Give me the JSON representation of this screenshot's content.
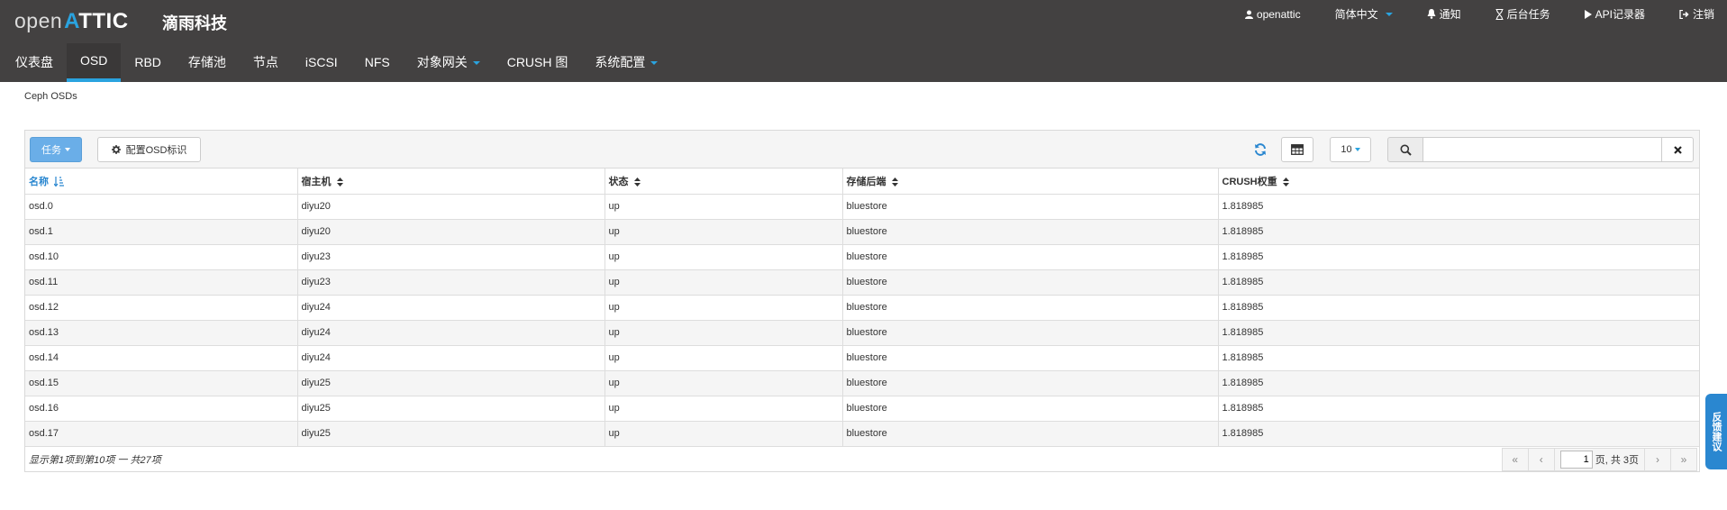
{
  "header": {
    "logo_open": "open",
    "logo_a": "A",
    "logo_ttic": "TTIC",
    "company": "滴雨科技",
    "user": "openattic",
    "language": "简体中文",
    "notifications": "通知",
    "background_tasks": "后台任务",
    "api_log": "API记录器",
    "logout": "注销"
  },
  "nav": {
    "tabs": [
      {
        "label": "仪表盘"
      },
      {
        "label": "OSD"
      },
      {
        "label": "RBD"
      },
      {
        "label": "存储池"
      },
      {
        "label": "节点"
      },
      {
        "label": "iSCSI"
      },
      {
        "label": "NFS"
      },
      {
        "label": "对象网关"
      },
      {
        "label": "CRUSH 图"
      },
      {
        "label": "系统配置"
      }
    ],
    "active": "OSD"
  },
  "breadcrumb": "Ceph OSDs",
  "toolbar": {
    "tasks_label": "任务",
    "configure_label": "配置OSD标识",
    "page_size": "10",
    "search_value": ""
  },
  "table": {
    "columns": [
      "名称",
      "宿主机",
      "状态",
      "存储后端",
      "CRUSH权重"
    ],
    "rows": [
      [
        "osd.0",
        "diyu20",
        "up",
        "bluestore",
        "1.818985"
      ],
      [
        "osd.1",
        "diyu20",
        "up",
        "bluestore",
        "1.818985"
      ],
      [
        "osd.10",
        "diyu23",
        "up",
        "bluestore",
        "1.818985"
      ],
      [
        "osd.11",
        "diyu23",
        "up",
        "bluestore",
        "1.818985"
      ],
      [
        "osd.12",
        "diyu24",
        "up",
        "bluestore",
        "1.818985"
      ],
      [
        "osd.13",
        "diyu24",
        "up",
        "bluestore",
        "1.818985"
      ],
      [
        "osd.14",
        "diyu24",
        "up",
        "bluestore",
        "1.818985"
      ],
      [
        "osd.15",
        "diyu25",
        "up",
        "bluestore",
        "1.818985"
      ],
      [
        "osd.16",
        "diyu25",
        "up",
        "bluestore",
        "1.818985"
      ],
      [
        "osd.17",
        "diyu25",
        "up",
        "bluestore",
        "1.818985"
      ]
    ]
  },
  "footer": {
    "info": "显示第1项到第10项 一 共27项",
    "current_page": "1",
    "total_pages": "页, 共 3页"
  },
  "feedback": "反馈建议",
  "colors": {
    "header_bg": "#434141",
    "accent": "#2aa3df",
    "primary_button": "#6aaee8"
  }
}
